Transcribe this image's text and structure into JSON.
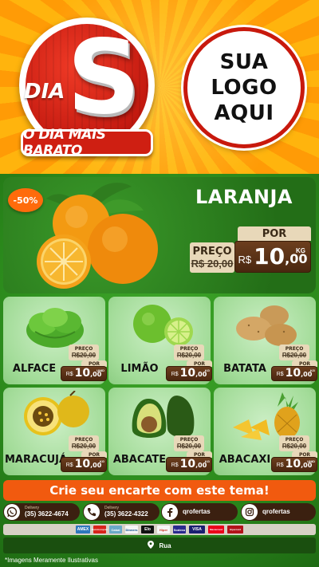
{
  "header": {
    "badge_word": "DIA",
    "badge_letter": "S",
    "badge_ribbon": "O DIA MAIS BARATO",
    "logo_lines": [
      "SUA",
      "LOGO",
      "AQUI"
    ]
  },
  "featured": {
    "name": "LARANJA",
    "discount": "-50%",
    "preco_label": "PREÇO",
    "old_price": "R$ 20,00",
    "por_label": "POR",
    "currency": "R$",
    "price_int": "10",
    "price_dec": ",00",
    "unit": "KG"
  },
  "products": [
    {
      "name": "ALFACE",
      "preco_label": "PREÇO",
      "old_price": "R$20,00",
      "por_label": "POR",
      "currency": "R$",
      "price_int": "10",
      "price_dec": ",00",
      "unit": "UNID"
    },
    {
      "name": "LIMÃO",
      "preco_label": "PREÇO",
      "old_price": "R$20,00",
      "por_label": "POR",
      "currency": "R$",
      "price_int": "10",
      "price_dec": ",00",
      "unit": "KG"
    },
    {
      "name": "BATATA",
      "preco_label": "PREÇO",
      "old_price": "R$20,00",
      "por_label": "POR",
      "currency": "R$",
      "price_int": "10",
      "price_dec": ",00",
      "unit": "KG"
    },
    {
      "name": "MARACUJÁ",
      "preco_label": "PREÇO",
      "old_price": "R$20,00",
      "por_label": "POR",
      "currency": "R$",
      "price_int": "10",
      "price_dec": ",00",
      "unit": "KG"
    },
    {
      "name": "ABACATE",
      "preco_label": "PREÇO",
      "old_price": "R$20,00",
      "por_label": "POR",
      "currency": "R$",
      "price_int": "10",
      "price_dec": ",00",
      "unit": "KG"
    },
    {
      "name": "ABACAXI",
      "preco_label": "PREÇO",
      "old_price": "R$20,00",
      "por_label": "POR",
      "currency": "R$",
      "price_int": "10",
      "price_dec": ",00",
      "unit": "UNID"
    }
  ],
  "cta": "Crie seu encarte com este tema!",
  "contacts": [
    {
      "icon": "whatsapp-icon",
      "label": "Delivery",
      "value": "(35) 3622-4674"
    },
    {
      "icon": "phone-icon",
      "label": "Delivery",
      "value": "(35) 3622-4322"
    },
    {
      "icon": "facebook-icon",
      "label": "",
      "value": "qrofertas"
    },
    {
      "icon": "instagram-icon",
      "label": "",
      "value": "qrofertas"
    }
  ],
  "payments": [
    "AMEX",
    "Banricompras",
    "Cabal",
    "Dinners",
    "Elo",
    "Hiper",
    "Sodexo",
    "VISA",
    "Mastercard",
    "Hipercard"
  ],
  "address": "Rua",
  "footnote": "*Imagens Meramente Ilustrativas",
  "colors": {
    "header_orange": "#ffb40d",
    "brand_red": "#c8190d",
    "green": "#2b8a1c",
    "card_green": "#a3dc99",
    "price_brown": "#5a3218",
    "cta_orange": "#f15a0f"
  }
}
